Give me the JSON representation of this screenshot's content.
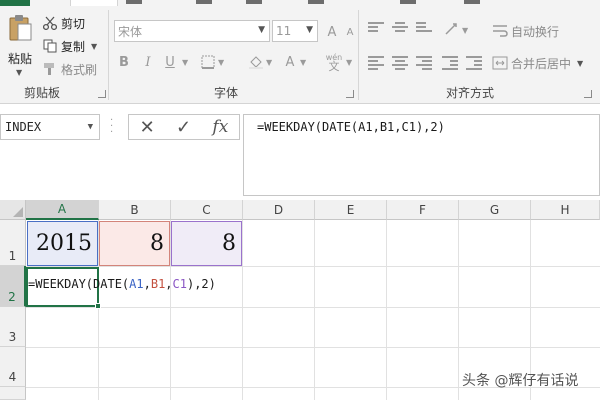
{
  "ribbon": {
    "clipboard": {
      "paste_label": "粘贴",
      "cut_label": "剪切",
      "copy_label": "复制",
      "format_painter_label": "格式刷",
      "group_label": "剪贴板"
    },
    "font": {
      "font_name_placeholder": "宋体",
      "font_size_value": "11",
      "bold_label": "B",
      "italic_label": "I",
      "underline_label": "U",
      "font_color_label": "A",
      "phonetic_label": "wén",
      "phonetic_char": "文",
      "group_label": "字体"
    },
    "alignment": {
      "wrap_text_label": "自动换行",
      "merge_center_label": "合并后居中",
      "group_label": "对齐方式"
    }
  },
  "formula_bar": {
    "name_box_value": "INDEX",
    "cancel_glyph": "✕",
    "enter_glyph": "✓",
    "fx_label": "fx",
    "formula_text": "=WEEKDAY(DATE(A1,B1,C1),2)"
  },
  "grid": {
    "columns": [
      "A",
      "B",
      "C",
      "D",
      "E",
      "F",
      "G",
      "H"
    ],
    "rows": [
      "1",
      "2",
      "3",
      "4"
    ],
    "cells": {
      "A1": "2015",
      "B1": "8",
      "C1": "8"
    },
    "editing": {
      "prefix": "=WEEKDAY(DATE(",
      "ref_a": "A1",
      "sep1": ",",
      "ref_b": "B1",
      "sep2": ",",
      "ref_c": "C1",
      "suffix": "),2)"
    }
  },
  "watermark": {
    "text": "头条 @辉仔有话说"
  },
  "colors": {
    "accent": "#217346",
    "ref_a": "#3a63c4",
    "ref_b": "#c3503f",
    "ref_c": "#8a56c4"
  }
}
